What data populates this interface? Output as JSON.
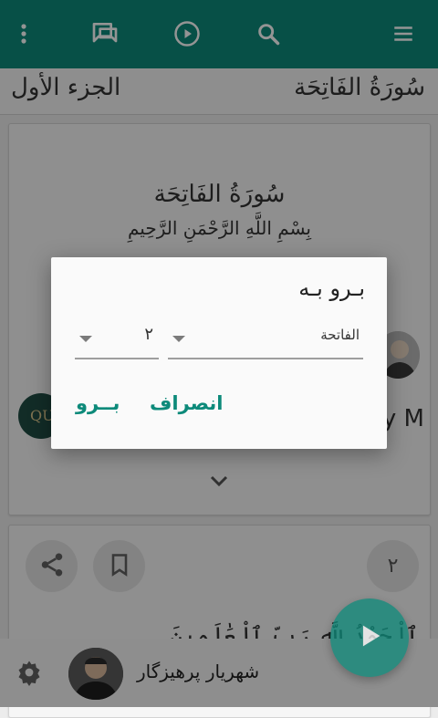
{
  "toolbar": {
    "icons": [
      "more-vert-icon",
      "chat-icon",
      "play-circle-icon",
      "search-icon",
      "menu-icon"
    ]
  },
  "header": {
    "surah_calligraphy": "سُورَةُ الفَاتِحَة",
    "juz_calligraphy": "الجزء الأول"
  },
  "surah_card": {
    "title_calligraphy": "سُورَةُ الفَاتِحَة",
    "basmala": "بِسْمِ اللَّهِ الرَّحْمَنِ الرَّحِيمِ",
    "partial_text_right": "y M",
    "partial_logo_text": "QUR"
  },
  "dialog": {
    "title": "بـرو بـه",
    "surah_select_value": "الفاتحة",
    "ayah_select_value": "۲",
    "go_label": "بــرو",
    "cancel_label": "انصراف"
  },
  "ayah_card": {
    "ayah_number": "۲",
    "ayah_text": "ٱلْحَمْدُ لِلَّهِ رَبِّ ٱلْعَٰلَمِينَ"
  },
  "player": {
    "reciter_name": "شهریار پرهیزگار"
  },
  "colors": {
    "accent": "#0d8a7a",
    "scrim": "rgba(0,0,0,0.42)"
  }
}
